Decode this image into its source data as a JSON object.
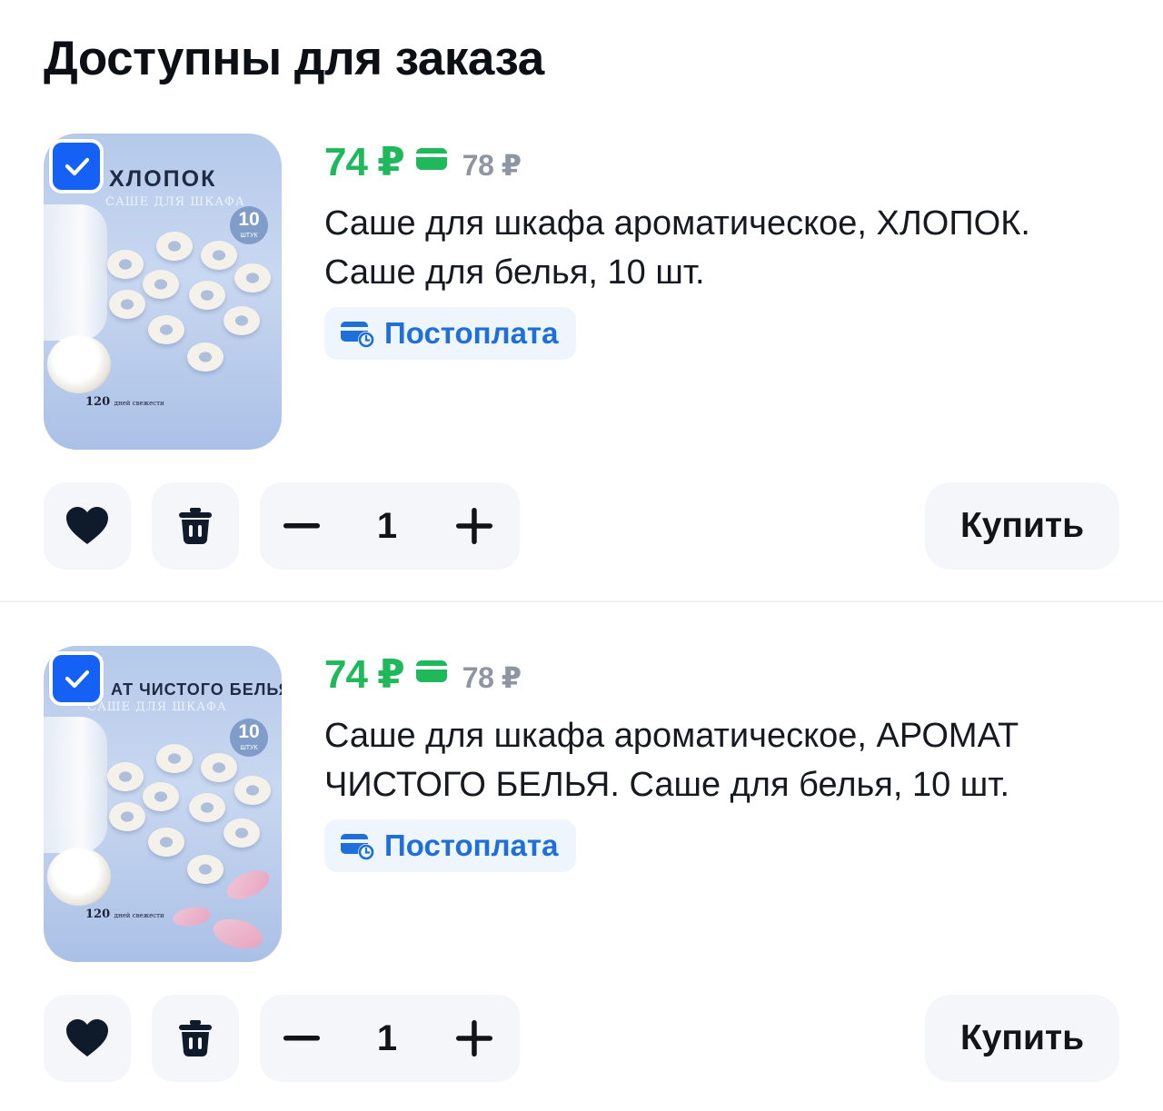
{
  "section": {
    "title": "Доступны для заказа"
  },
  "items": [
    {
      "checked": true,
      "price": "74 ₽",
      "old_price": "78 ₽",
      "title": "Саше для шкафа ароматическое, ХЛОПОК. Саше для белья, 10 шт.",
      "badge": "Постоплата",
      "quantity": "1",
      "buy_label": "Купить",
      "image": {
        "top_label": "ХЛОПОК",
        "sub_label": "САШЕ ДЛЯ ШКАФА",
        "count": "10",
        "count_unit": "ШТУК",
        "days": "120",
        "days_label": "дней свежести"
      }
    },
    {
      "checked": true,
      "price": "74 ₽",
      "old_price": "78 ₽",
      "title": "Саше для шкафа ароматическое, АРОМАТ ЧИСТОГО БЕЛЬЯ. Саше для белья, 10 шт.",
      "badge": "Постоплата",
      "quantity": "1",
      "buy_label": "Купить",
      "image": {
        "top_label": "АТ ЧИСТОГО БЕЛЬЯ",
        "sub_label": "САШЕ ДЛЯ ШКАФА",
        "count": "10",
        "count_unit": "ШТУК",
        "days": "120",
        "days_label": "дней свежести"
      }
    }
  ],
  "colors": {
    "accent_blue": "#1560f5",
    "price_green": "#1fb85a",
    "postpay_blue": "#1e6fd9",
    "button_bg": "#f4f6f9"
  },
  "icons": [
    "check-icon",
    "wallet-icon",
    "postpay-card-clock-icon",
    "heart-icon",
    "trash-icon",
    "minus-icon",
    "plus-icon"
  ]
}
